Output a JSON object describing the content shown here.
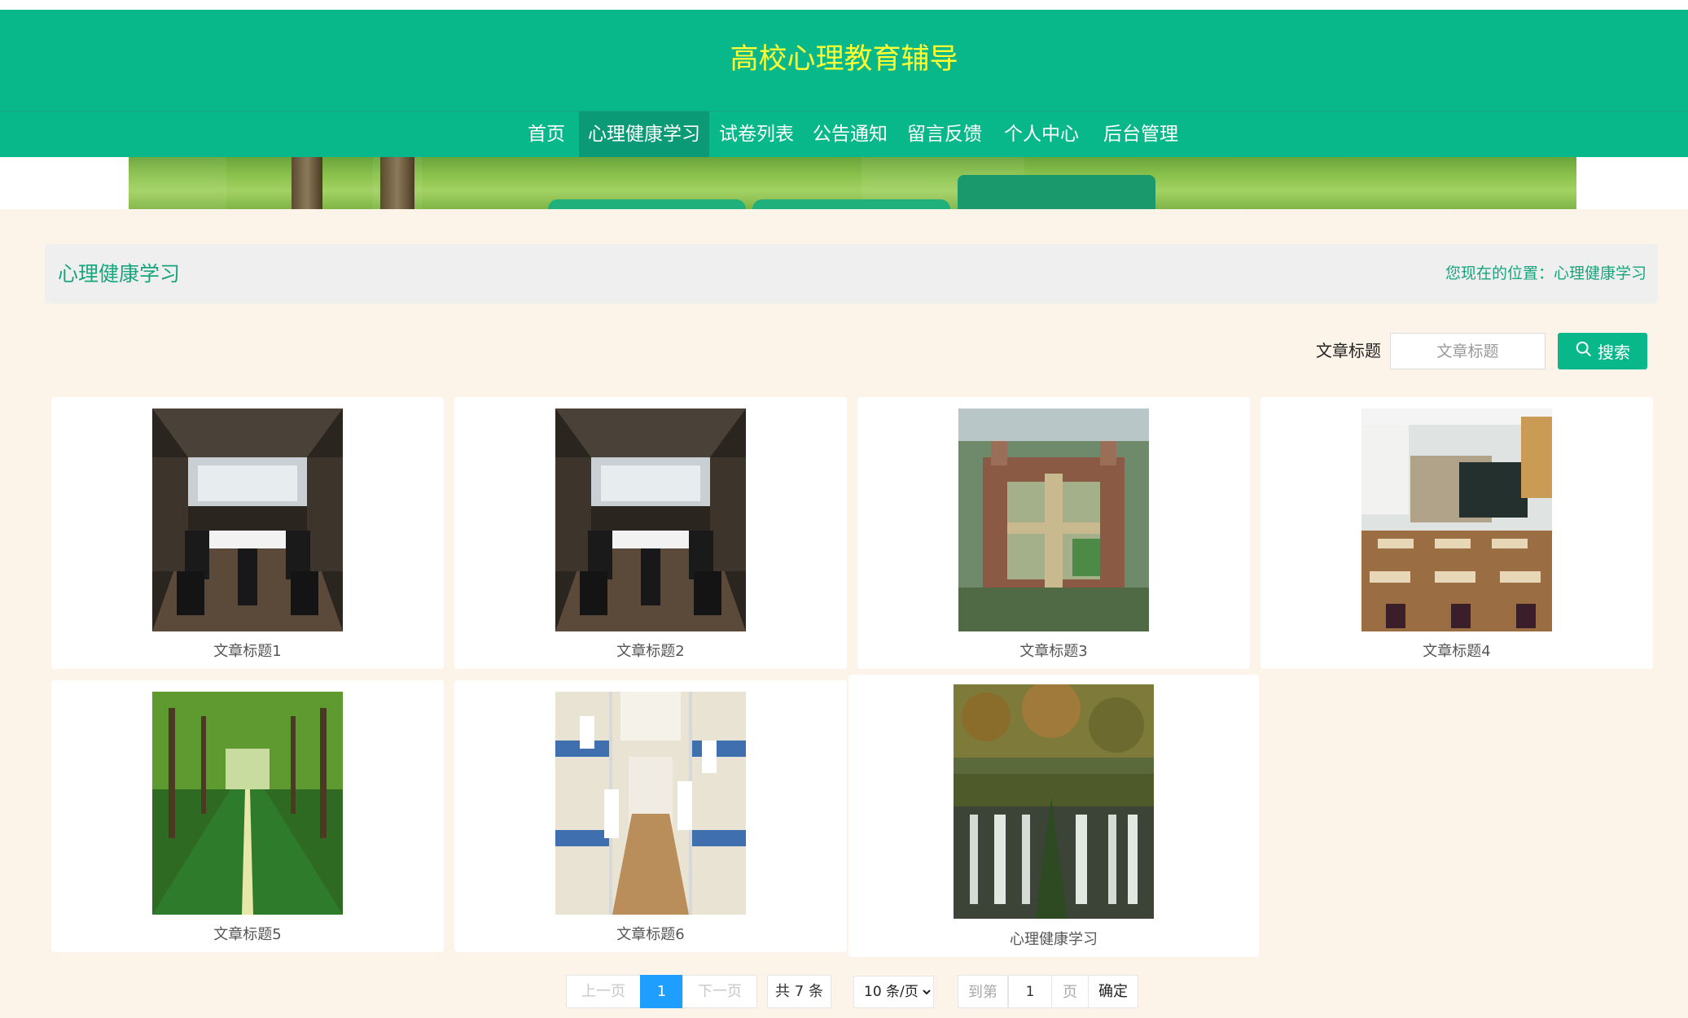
{
  "site": {
    "title": "高校心理教育辅导"
  },
  "nav": {
    "items": [
      {
        "label": "首页"
      },
      {
        "label": "心理健康学习",
        "active": true
      },
      {
        "label": "试卷列表"
      },
      {
        "label": "公告通知"
      },
      {
        "label": "留言反馈"
      },
      {
        "label": "个人中心"
      },
      {
        "label": "后台管理"
      }
    ]
  },
  "page": {
    "title": "心理健康学习",
    "location": "您现在的位置：心理健康学习"
  },
  "search": {
    "label": "文章标题",
    "placeholder": "文章标题",
    "value": "",
    "button_label": "搜索"
  },
  "articles": [
    {
      "title": "文章标题1",
      "image": "conference-room-photo"
    },
    {
      "title": "文章标题2",
      "image": "conference-room-photo"
    },
    {
      "title": "文章标题3",
      "image": "campus-aerial-photo"
    },
    {
      "title": "文章标题4",
      "image": "classroom-photo"
    },
    {
      "title": "文章标题5",
      "image": "tree-lined-road-photo"
    },
    {
      "title": "文章标题6",
      "image": "dormitory-photo"
    },
    {
      "title": "心理健康学习",
      "image": "waterfall-forest-photo"
    }
  ],
  "pagination": {
    "prev_label": "上一页",
    "current_page": "1",
    "next_label": "下一页",
    "total_label": "共 7 条",
    "page_size_label": "10 条/页",
    "goto_label": "到第",
    "goto_value": "1",
    "page_suffix": "页",
    "confirm_label": "确定"
  },
  "colors": {
    "header_bg": "#08b88a",
    "title_text": "#ffff33",
    "accent": "#17a57d",
    "page_bg": "#fcf4e8",
    "pager_current": "#1e9fff"
  }
}
